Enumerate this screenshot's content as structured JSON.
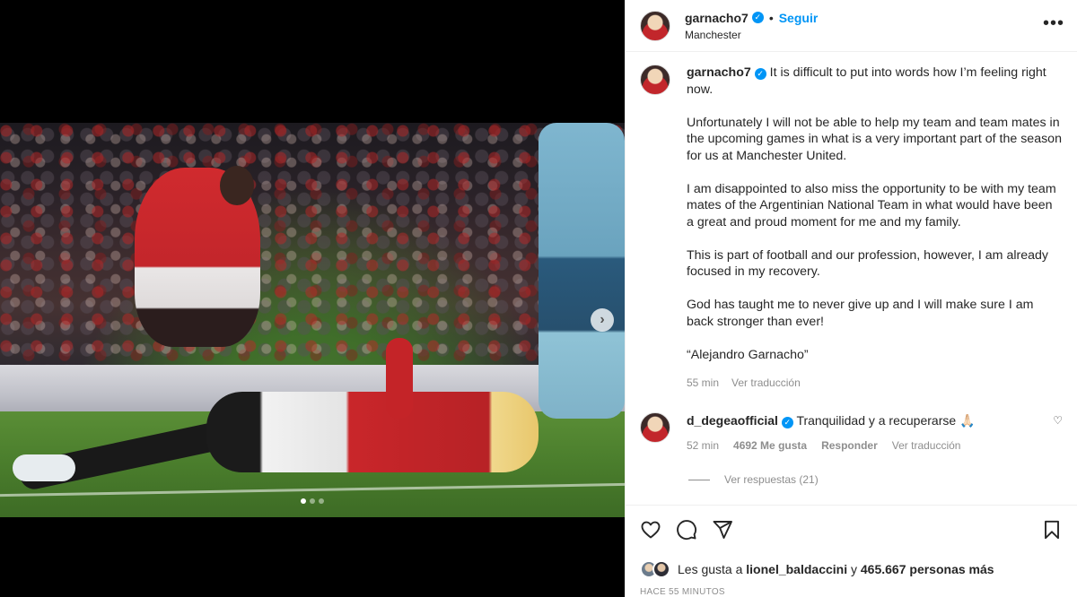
{
  "post": {
    "carousel": {
      "dots_total": 3,
      "dots_active_index": 0,
      "next_icon": "chevron-right-icon"
    },
    "author": {
      "username": "garnacho7",
      "verified": true,
      "follow_label": "Seguir",
      "separator": "•",
      "location": "Manchester"
    },
    "more_icon": "ellipsis-icon",
    "caption": {
      "username": "garnacho7",
      "paragraphs": [
        "It is difficult to put into words how I’m feeling right now.",
        "Unfortunately I will not be able to help my team and team mates in the upcoming games in what is a very important part of the season for us at Manchester United.",
        "I am disappointed to also miss the opportunity to be with my team mates of the Argentinian National Team in what would have been a great and proud moment for me and my family.",
        "This is part of football and our profession, however, I am already focused in my recovery.",
        "God has taught me to never give up and I will make sure I am back stronger than ever!",
        "“Alejandro Garnacho”"
      ],
      "time": "55 min",
      "translate": "Ver traducción"
    },
    "comment": {
      "username": "d_degeaofficial",
      "text": "Tranquilidad y a recuperarse 🙏🏻",
      "time": "52 min",
      "likes": "4692 Me gusta",
      "reply": "Responder",
      "translate": "Ver traducción",
      "view_replies": "Ver respuestas (21)"
    },
    "actions": {
      "like_icon": "heart-icon",
      "comment_icon": "comment-icon",
      "share_icon": "send-icon",
      "save_icon": "bookmark-icon"
    },
    "likes": {
      "prefix": "Les gusta a",
      "user": "lionel_baldaccini",
      "conj": "y",
      "others": "465.667 personas más"
    },
    "posted": "HACE 55 MINUTOS"
  },
  "colors": {
    "accent": "#0095f6",
    "muted": "#8e8e8e",
    "text": "#262626"
  }
}
